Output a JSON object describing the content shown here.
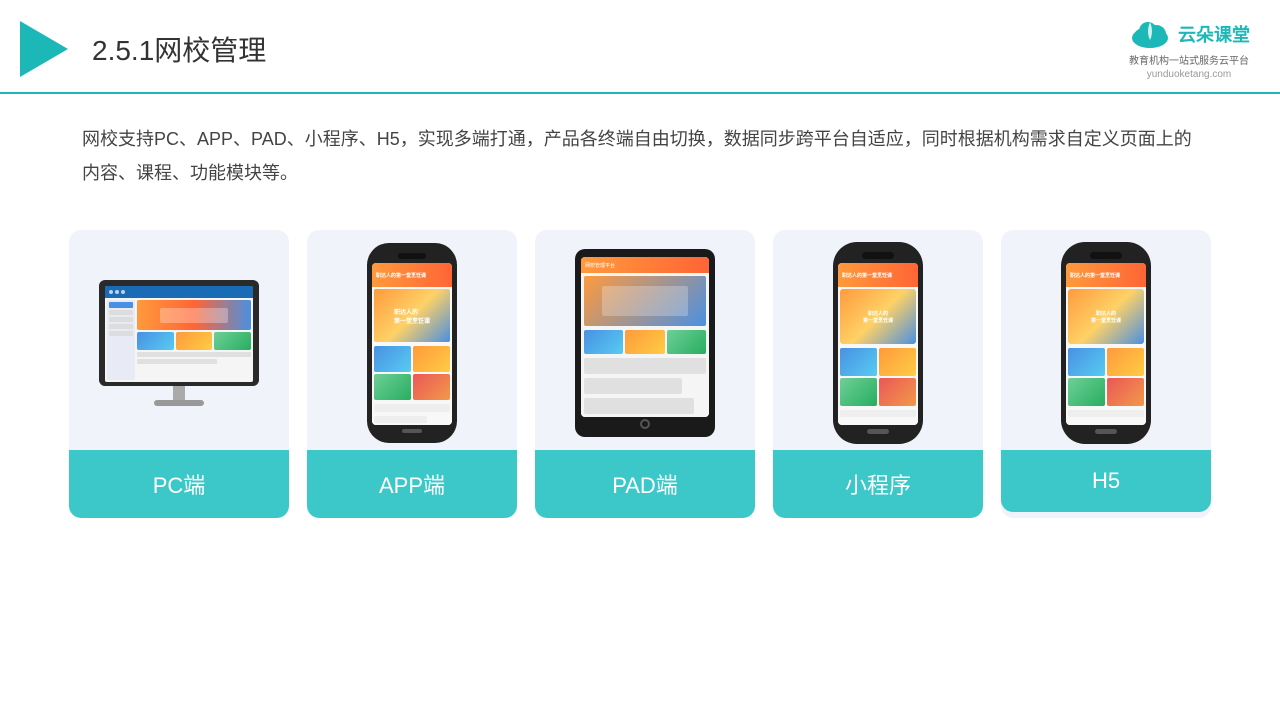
{
  "header": {
    "title_num": "2.5.1",
    "title_text": "网校管理",
    "brand_name": "云朵课堂",
    "brand_url": "yunduoketang.com",
    "brand_slogan": "教育机构一站式服务云平台"
  },
  "description": {
    "text": "网校支持PC、APP、PAD、小程序、H5，实现多端打通，产品各终端自由切换，数据同步跨平台自适应，同时根据机构需求自定义页面上的内容、课程、功能模块等。"
  },
  "cards": [
    {
      "id": "pc",
      "label": "PC端"
    },
    {
      "id": "app",
      "label": "APP端"
    },
    {
      "id": "pad",
      "label": "PAD端"
    },
    {
      "id": "mini",
      "label": "小程序"
    },
    {
      "id": "h5",
      "label": "H5"
    }
  ],
  "colors": {
    "accent": "#1cb8b8",
    "card_bg": "#eef2fa",
    "label_bg": "#3cc8c8"
  }
}
